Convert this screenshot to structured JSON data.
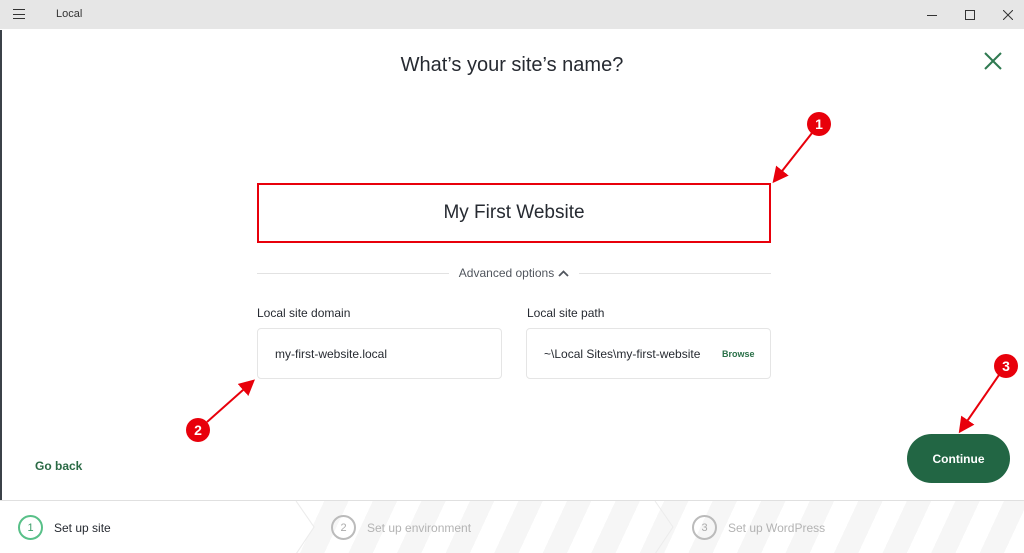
{
  "window": {
    "app_title": "Local",
    "controls": {
      "minimize": "minimize",
      "maximize": "maximize",
      "close": "close"
    }
  },
  "header": {
    "title": "What’s your site’s name?"
  },
  "form": {
    "site_name_value": "My First Website",
    "advanced_options_label": "Advanced options",
    "domain": {
      "label": "Local site domain",
      "value": "my-first-website.local"
    },
    "path": {
      "label": "Local site path",
      "value": "~\\Local Sites\\my-first-website",
      "browse_label": "Browse"
    }
  },
  "footer": {
    "go_back_label": "Go back",
    "continue_label": "Continue"
  },
  "steps": [
    {
      "number": "1",
      "label": "Set up site",
      "active": true
    },
    {
      "number": "2",
      "label": "Set up environment",
      "active": false
    },
    {
      "number": "3",
      "label": "Set up WordPress",
      "active": false
    }
  ],
  "annotations": [
    {
      "number": "1",
      "target": "site-name-input"
    },
    {
      "number": "2",
      "target": "local-site-domain-field"
    },
    {
      "number": "3",
      "target": "continue-button"
    }
  ],
  "colors": {
    "brand_green": "#226644",
    "annotation_red": "#e8000b",
    "active_step_green": "#58c088"
  }
}
